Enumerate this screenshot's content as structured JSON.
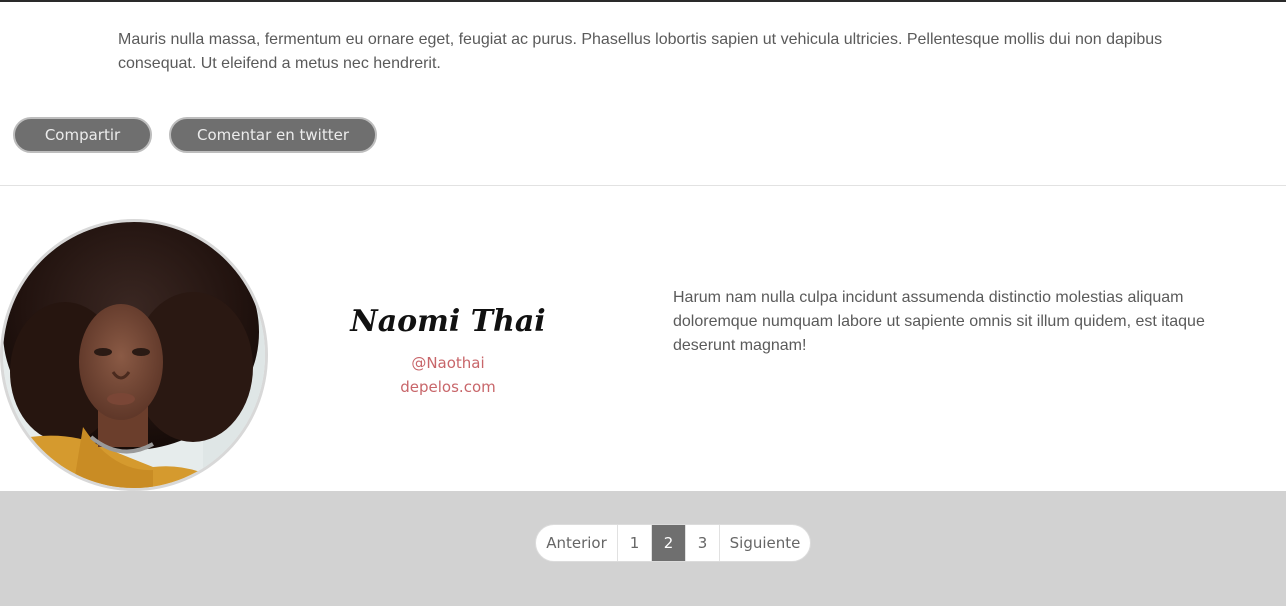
{
  "article": {
    "text": "Mauris nulla massa, fermentum eu ornare eget, feugiat ac purus. Phasellus lobortis sapien ut vehicula ultricies. Pellentesque mollis dui non dapibus consequat. Ut eleifend a metus nec hendrerit."
  },
  "actions": {
    "share_label": "Compartir",
    "tweet_label": "Comentar en twitter"
  },
  "author": {
    "name": "Naomi Thai",
    "handle": "@Naothai",
    "site": "depelos.com",
    "bio": "Harum nam nulla culpa incidunt assumenda distinctio molestias aliquam doloremque numquam labore ut sapiente omnis sit illum quidem, est itaque deserunt magnam!"
  },
  "pagination": {
    "prev": "Anterior",
    "pages": [
      "1",
      "2",
      "3"
    ],
    "current": "2",
    "next": "Siguiente"
  },
  "colors": {
    "button_bg": "#6f6f6f",
    "link": "#c8666a",
    "footer_bg": "#d2d2d2"
  }
}
